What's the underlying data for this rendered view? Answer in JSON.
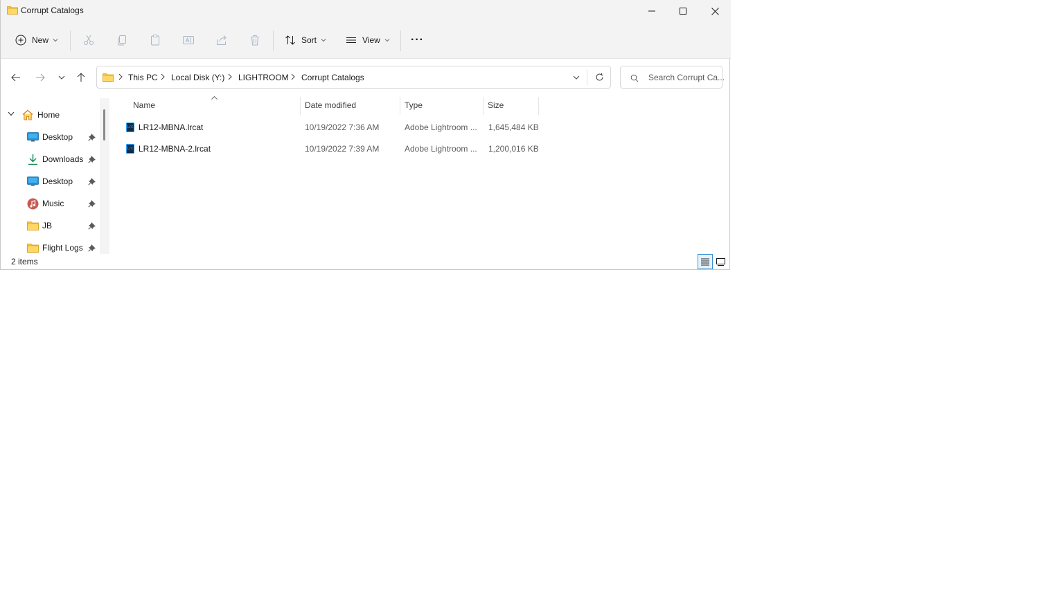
{
  "window": {
    "title": "Corrupt Catalogs"
  },
  "caption": {
    "minimize_icon": "minimize-icon",
    "maximize_icon": "maximize-icon",
    "close_icon": "close-icon"
  },
  "toolbar": {
    "new_label": "New",
    "sort_label": "Sort",
    "view_label": "View",
    "more_label": "···",
    "icons": [
      "cut-icon",
      "copy-icon",
      "paste-icon",
      "rename-icon",
      "share-icon",
      "delete-icon"
    ]
  },
  "breadcrumb": [
    "This PC",
    "Local Disk (Y:)",
    "LIGHTROOM",
    "Corrupt Catalogs"
  ],
  "search": {
    "placeholder": "Search Corrupt Ca..."
  },
  "sidebar": {
    "items": [
      {
        "label": "Home",
        "icon": "home-icon",
        "pinned": false
      },
      {
        "label": "Desktop",
        "icon": "desktop-icon",
        "pinned": true
      },
      {
        "label": "Downloads",
        "icon": "downloads-icon",
        "pinned": true
      },
      {
        "label": "Desktop",
        "icon": "desktop-icon",
        "pinned": true
      },
      {
        "label": "Music",
        "icon": "music-icon",
        "pinned": true
      },
      {
        "label": "JB",
        "icon": "folder-icon",
        "pinned": true
      },
      {
        "label": "Flight Logs",
        "icon": "folder-icon",
        "pinned": true
      }
    ]
  },
  "columns": {
    "name": "Name",
    "date": "Date modified",
    "type": "Type",
    "size": "Size"
  },
  "files": [
    {
      "name": "LR12-MBNA.lrcat",
      "date": "10/19/2022 7:36 AM",
      "type": "Adobe Lightroom ...",
      "size": "1,645,484 KB",
      "icon_label": "Lrc"
    },
    {
      "name": "LR12-MBNA-2.lrcat",
      "date": "10/19/2022 7:39 AM",
      "type": "Adobe Lightroom ...",
      "size": "1,200,016 KB",
      "icon_label": "Lrc"
    }
  ],
  "status": {
    "items": "2 items"
  },
  "colors": {
    "accent": "#0067c0",
    "folder": "#f8c642",
    "titlebar": "#f3f3f3",
    "lightroom_blue": "#31a8ff"
  }
}
